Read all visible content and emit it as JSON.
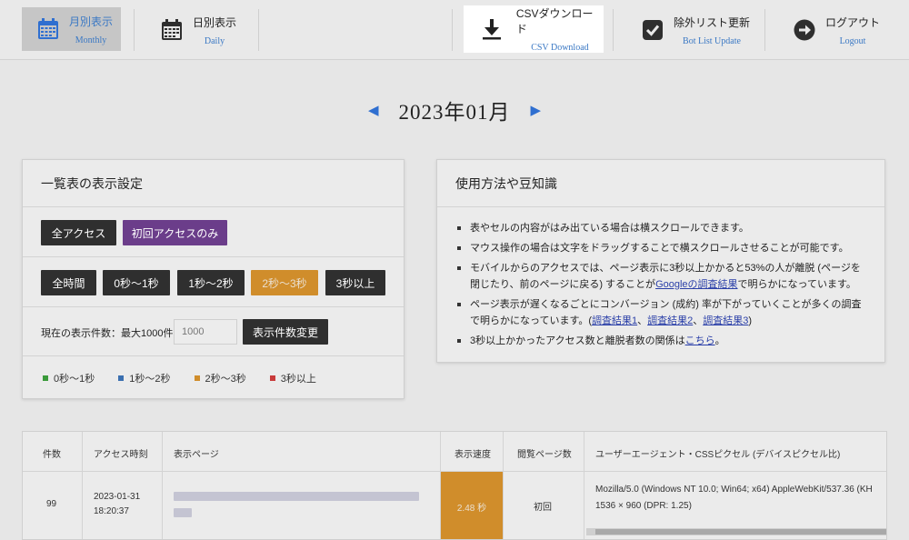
{
  "nav": {
    "monthly": {
      "ja": "月別表示",
      "en": "Monthly",
      "icon": "calendar-icon"
    },
    "daily": {
      "ja": "日別表示",
      "en": "Daily",
      "icon": "calendar-icon"
    },
    "csv": {
      "ja": "CSVダウンロード",
      "en": "CSV Download",
      "icon": "download-icon"
    },
    "bot": {
      "ja": "除外リスト更新",
      "en": "Bot List Update",
      "icon": "checkbox-icon"
    },
    "logout": {
      "ja": "ログアウト",
      "en": "Logout",
      "icon": "arrow-right-circle-icon"
    }
  },
  "month": {
    "prev": "◀",
    "title": "2023年01月",
    "next": "▶"
  },
  "settings": {
    "title": "一覧表の表示設定",
    "access_all": "全アクセス",
    "access_first": "初回アクセスのみ",
    "time_filters": [
      "全時間",
      "0秒〜1秒",
      "1秒〜2秒",
      "2秒〜3秒",
      "3秒以上"
    ],
    "active_time_filter": "2秒〜3秒",
    "limit_label": "現在の表示件数：最大1000件",
    "limit_value": "1000",
    "limit_button": "表示件数変更",
    "legend": [
      {
        "label": "0秒〜1秒",
        "color": "#3a9a3a"
      },
      {
        "label": "1秒〜2秒",
        "color": "#3a6fb0"
      },
      {
        "label": "2秒〜3秒",
        "color": "#d08d2b"
      },
      {
        "label": "3秒以上",
        "color": "#c83a3a"
      }
    ]
  },
  "tips": {
    "title": "使用方法や豆知識",
    "items": [
      {
        "text": "表やセルの内容がはみ出ている場合は横スクロールできます。"
      },
      {
        "text": "マウス操作の場合は文字をドラッグすることで横スクロールさせることが可能です。"
      },
      {
        "pre": "モバイルからのアクセスでは、ページ表示に3秒以上かかると53%の人が離脱 (ページを閉じたり、前のページに戻る) することが",
        "link": "Googleの調査結果",
        "post": "で明らかになっています。"
      },
      {
        "pre": "ページ表示が遅くなるごとにコンバージョン (成約) 率が下がっていくことが多くの調査で明らかになっています。(",
        "links": [
          "調査結果1",
          "調査結果2",
          "調査結果3"
        ],
        "post": ")"
      },
      {
        "pre": "3秒以上かかったアクセス数と離脱者数の関係は",
        "link": "こちら",
        "post": "。"
      }
    ]
  },
  "table": {
    "headers": [
      "件数",
      "アクセス時刻",
      "表示ページ",
      "表示速度",
      "閲覧ページ数",
      "ユーザーエージェント・CSSピクセル (デバイスピクセル比)"
    ],
    "rows": [
      {
        "count": "99",
        "date": "2023-01-31",
        "time": "18:20:37",
        "speed": "2.48 秒",
        "pages": "初回",
        "ua": "Mozilla/5.0 (Windows NT 10.0; Win64; x64) AppleWebKit/537.36 (KH",
        "css": "1536 × 960  (DPR: 1.25)"
      }
    ]
  }
}
